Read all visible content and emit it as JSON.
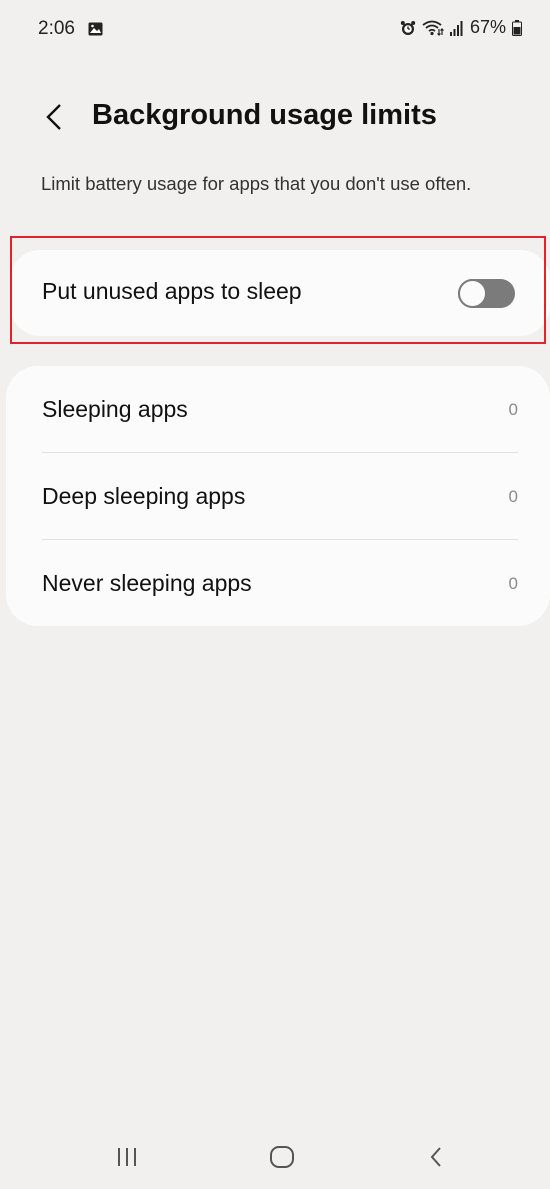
{
  "status_bar": {
    "time": "2:06",
    "battery_text": "67%"
  },
  "header": {
    "title": "Background usage limits"
  },
  "description": "Limit battery usage for apps that you don't use often.",
  "toggle": {
    "label": "Put unused apps to sleep",
    "state": "off"
  },
  "list": [
    {
      "label": "Sleeping apps",
      "count": "0"
    },
    {
      "label": "Deep sleeping apps",
      "count": "0"
    },
    {
      "label": "Never sleeping apps",
      "count": "0"
    }
  ],
  "icons": {
    "status": [
      "gallery-icon",
      "alarm-icon",
      "wifi-icon",
      "signal-icon",
      "battery-icon"
    ],
    "header": "back-arrow-icon",
    "nav": [
      "recents-icon",
      "home-icon",
      "back-icon"
    ]
  },
  "colors": {
    "background": "#f1f0ef",
    "card": "#fbfbfb",
    "toggle_off": "#7b7b7b",
    "highlight": "#e0242b"
  }
}
